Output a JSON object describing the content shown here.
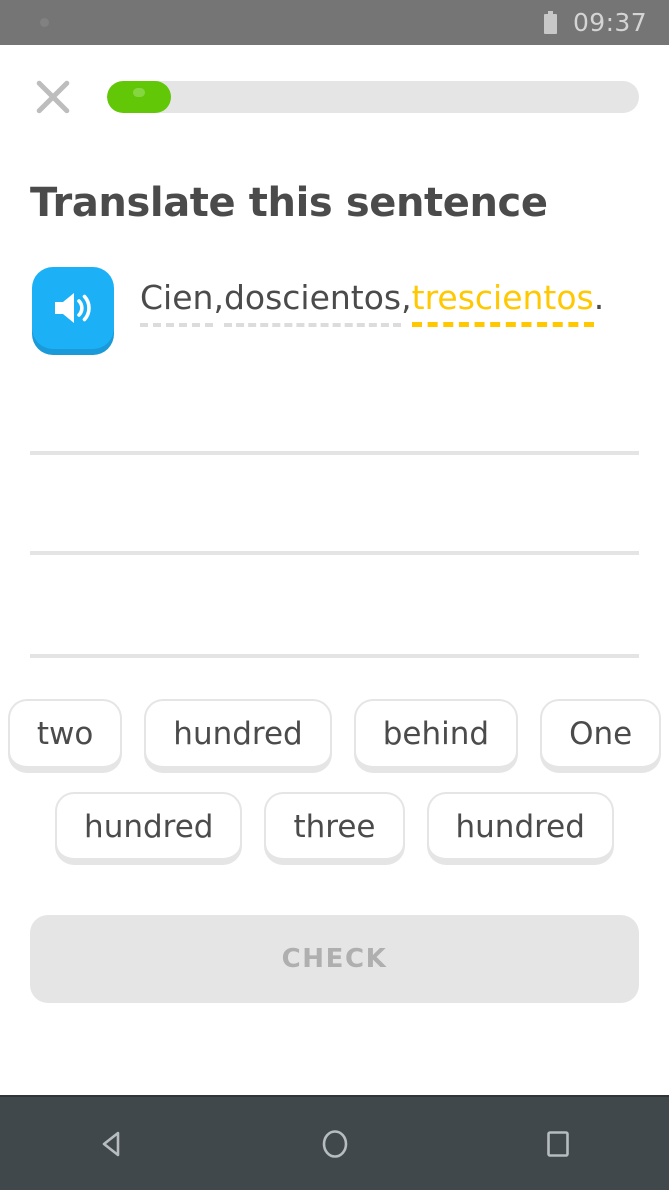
{
  "status_bar": {
    "time": "09:37",
    "battery_icon": "battery-icon",
    "notification_dot": "notification-dot"
  },
  "header": {
    "close_icon": "close-icon",
    "progress_percent": 12,
    "progress_fill_color": "#61c706",
    "progress_track_color": "#e5e5e5"
  },
  "exercise": {
    "title": "Translate this sentence",
    "speaker_icon": "speaker-icon",
    "speaker_color": "#1cb0f6",
    "sentence": {
      "words": [
        {
          "text": "Cien",
          "hinted": true,
          "focus": false
        },
        {
          "text": ", ",
          "hinted": false,
          "focus": false
        },
        {
          "text": "doscientos",
          "hinted": true,
          "focus": false
        },
        {
          "text": ", ",
          "hinted": false,
          "focus": false
        },
        {
          "text": "trescientos",
          "hinted": true,
          "focus": true
        },
        {
          "text": ".",
          "hinted": false,
          "focus": false
        }
      ],
      "plain": "Cien, doscientos, trescientos.",
      "focus_word": "trescientos",
      "focus_color": "#ffc800"
    },
    "answer_lines": [
      "",
      "",
      ""
    ],
    "word_bank": {
      "rows": [
        [
          "two",
          "hundred",
          "behind",
          "One"
        ],
        [
          "hundred",
          "three",
          "hundred"
        ]
      ]
    }
  },
  "check_button": {
    "label": "CHECK",
    "enabled": false
  },
  "nav_bar": {
    "back_icon": "back-triangle-icon",
    "home_icon": "home-circle-icon",
    "recents_icon": "recents-square-icon"
  }
}
